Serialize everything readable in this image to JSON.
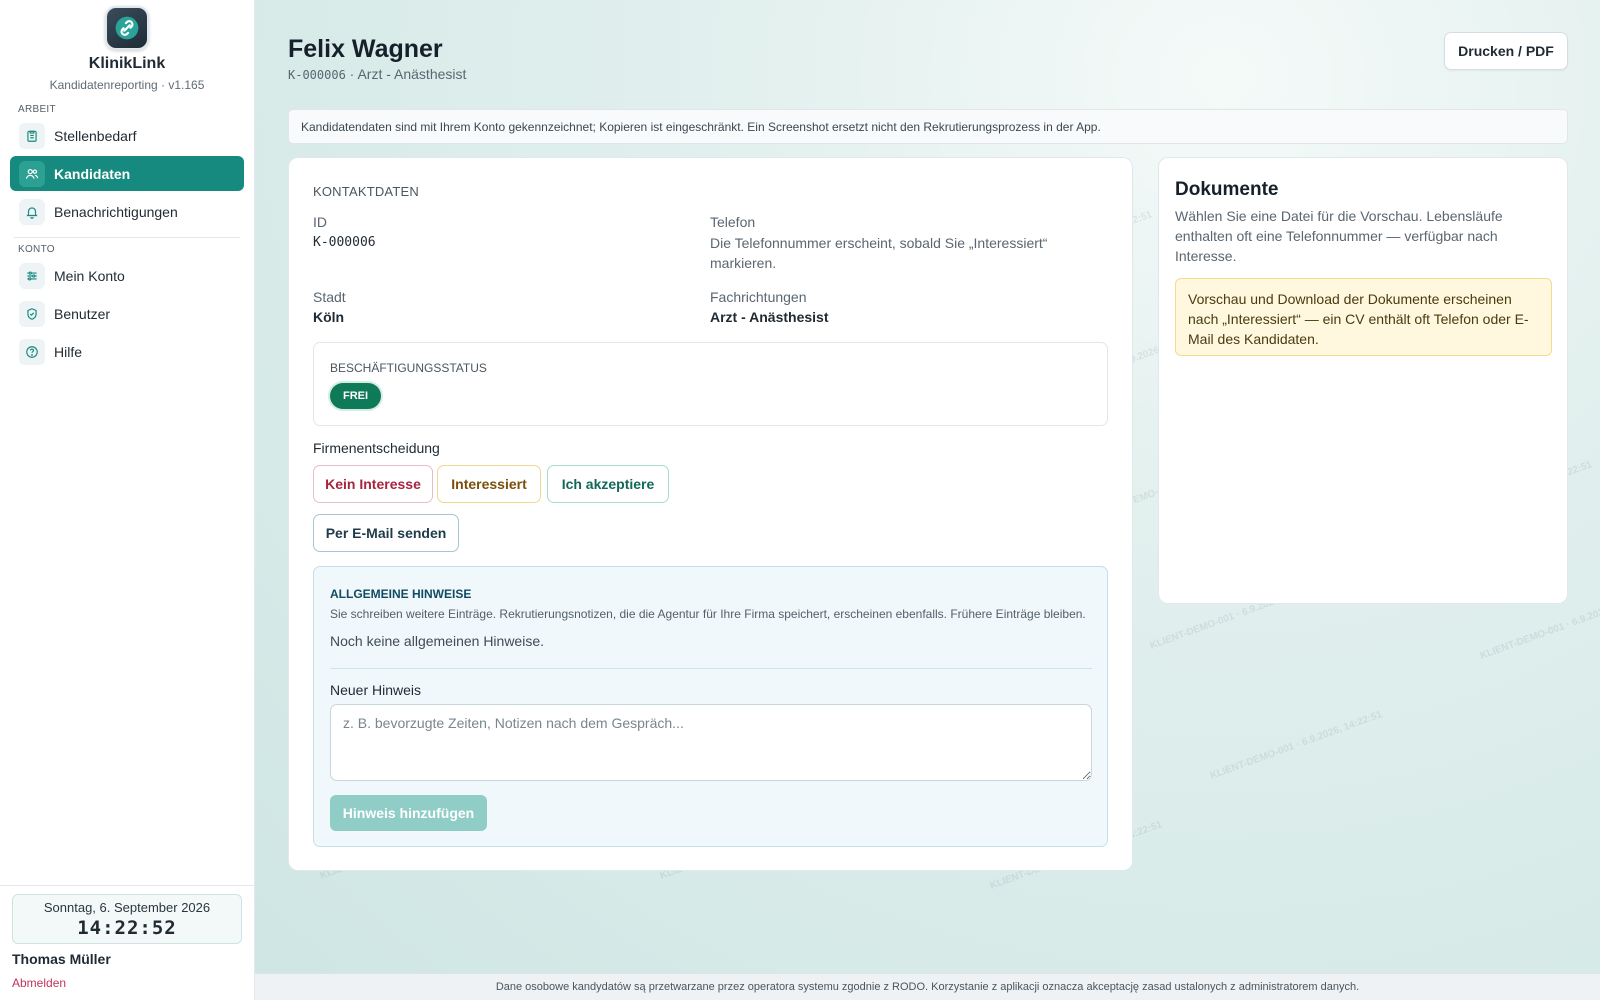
{
  "app": {
    "name": "KlinikLink",
    "subtitle": "Kandidatenreporting · v1.165"
  },
  "sidebar": {
    "section_work": "ARBEIT",
    "section_account": "KONTO",
    "items": [
      {
        "label": "Stellenbedarf",
        "icon": "clipboard-icon"
      },
      {
        "label": "Kandidaten",
        "icon": "users-icon",
        "active": true
      },
      {
        "label": "Benachrichtigungen",
        "icon": "bell-icon"
      },
      {
        "label": "Mein Konto",
        "icon": "sliders-icon"
      },
      {
        "label": "Benutzer",
        "icon": "shield-icon"
      },
      {
        "label": "Hilfe",
        "icon": "help-icon"
      }
    ],
    "clock": {
      "date": "Sonntag, 6. September 2026",
      "time": "14:22:52"
    },
    "user": "Thomas Müller",
    "logout": "Abmelden"
  },
  "header": {
    "title": "Felix Wagner",
    "id_code": "K-000006",
    "subtitle_rest": " · Arzt - Anästhesist",
    "print_button": "Drucken / PDF"
  },
  "notice": "Kandidatendaten sind mit Ihrem Konto gekennzeichnet; Kopieren ist eingeschränkt. Ein Screenshot ersetzt nicht den Rekrutierungsprozess in der App.",
  "contact": {
    "heading": "KONTAKTDATEN",
    "id_label": "ID",
    "id_value": "K-000006",
    "phone_label": "Telefon",
    "phone_value": "Die Telefonnummer erscheint, sobald Sie „Interessiert“ markieren.",
    "city_label": "Stadt",
    "city_value": "Köln",
    "specialty_label": "Fachrichtungen",
    "specialty_value": "Arzt - Anästhesist"
  },
  "employment": {
    "label": "BESCHÄFTIGUNGSSTATUS",
    "badge": "FREI",
    "badge_color": "#0f7a58"
  },
  "decision": {
    "label": "Firmenentscheidung",
    "no_interest": "Kein Interesse",
    "interested": "Interessiert",
    "accept": "Ich akzeptiere",
    "send_email": "Per E-Mail senden"
  },
  "hints": {
    "heading": "ALLGEMEINE HINWEISE",
    "description": "Sie schreiben weitere Einträge. Rekrutierungsnotizen, die die Agentur für Ihre Firma speichert, erscheinen ebenfalls. Frühere Einträge bleiben.",
    "empty": "Noch keine allgemeinen Hinweise.",
    "new_label": "Neuer Hinweis",
    "placeholder": "z. B. bevorzugte Zeiten, Notizen nach dem Gespräch...",
    "add_button": "Hinweis hinzufügen"
  },
  "documents": {
    "heading": "Dokumente",
    "description": "Wählen Sie eine Datei für die Vorschau. Lebensläufe enthalten oft eine Telefonnummer — verfügbar nach Interesse.",
    "warning": "Vorschau und Download der Dokumente erscheinen nach „Interessiert“ — ein CV enthält oft Telefon oder E-Mail des Kandidaten."
  },
  "watermark": "KLIENT-DEMO-001 · 6.9.2026, 14:22:51",
  "footer": "Dane osobowe kandydatów są przetwarzane przez operatora systemu zgodnie z RODO. Korzystanie z aplikacji oznacza akceptację zasad ustalonych z administratorem danych.",
  "colors": {
    "accent": "#178a80",
    "danger": "#a8243f",
    "warning": "#7b4f0a"
  }
}
